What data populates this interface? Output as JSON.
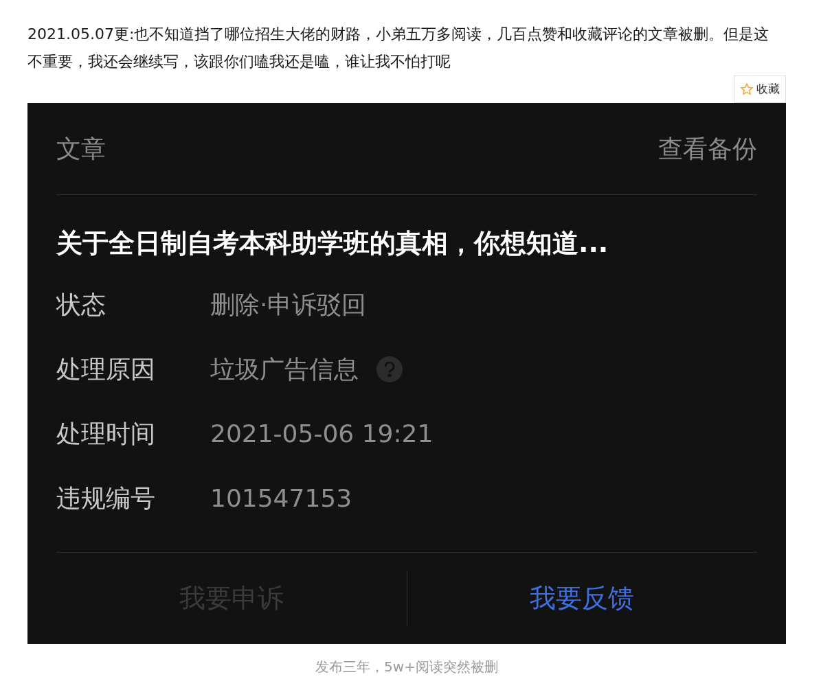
{
  "intro": "2021.05.07更:也不知道挡了哪位招生大佬的财路，小弟五万多阅读，几百点赞和收藏评论的文章被删。但是这不重要，我还会继续写，该跟你们嗑我还是嗑，谁让我不怕打呢",
  "collect_button": {
    "label": "收藏"
  },
  "card": {
    "header": {
      "title": "文章",
      "action": "查看备份"
    },
    "article_title": "关于全日制自考本科助学班的真相，你想知道...",
    "fields": [
      {
        "label": "状态",
        "value": "删除·申诉驳回",
        "help": false
      },
      {
        "label": "处理原因",
        "value": "垃圾广告信息",
        "help": true
      },
      {
        "label": "处理时间",
        "value": "2021-05-06 19:21",
        "help": false
      },
      {
        "label": "违规编号",
        "value": "101547153",
        "help": false
      }
    ],
    "buttons": [
      {
        "label": "我要申诉",
        "disabled": true
      },
      {
        "label": "我要反馈",
        "disabled": false
      }
    ]
  },
  "caption": "发布三年，5w+阅读突然被删"
}
